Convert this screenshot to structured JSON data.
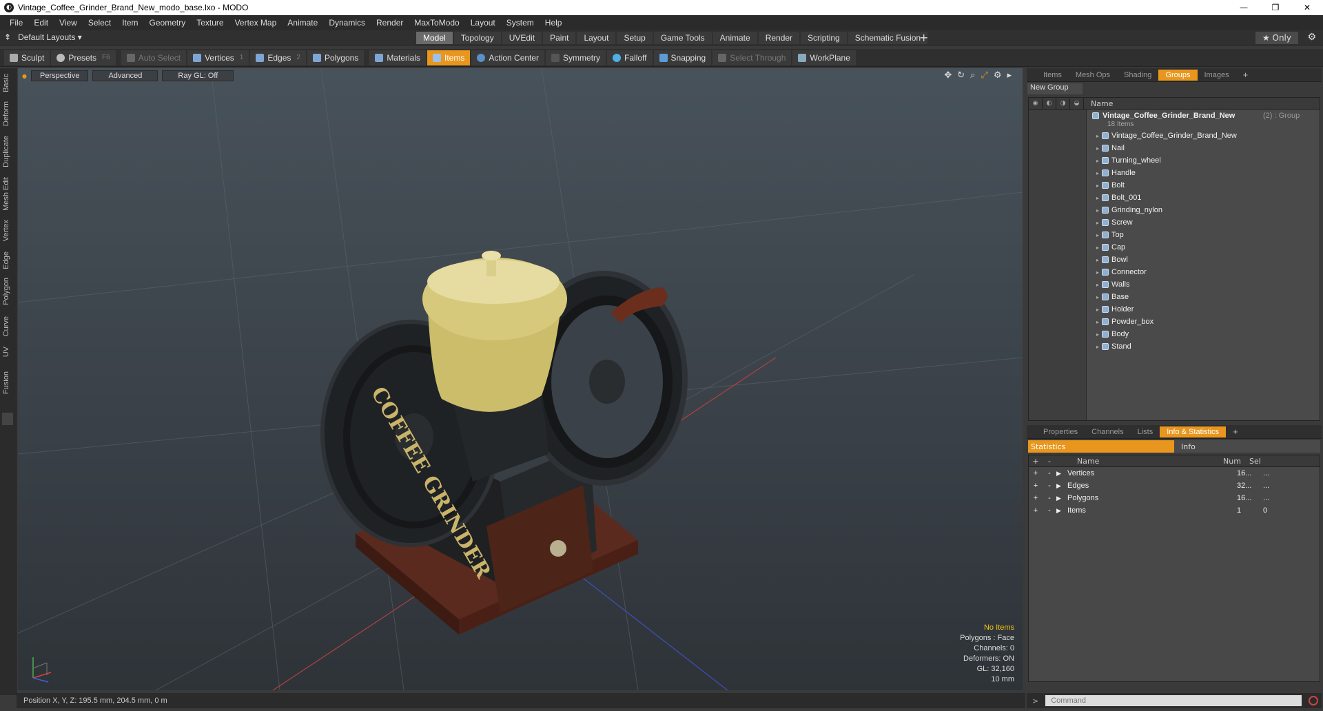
{
  "window": {
    "title": "Vintage_Coffee_Grinder_Brand_New_modo_base.lxo - MODO",
    "minimize": "—",
    "maximize": "❐",
    "close": "✕"
  },
  "menu": [
    "File",
    "Edit",
    "View",
    "Select",
    "Item",
    "Geometry",
    "Texture",
    "Vertex Map",
    "Animate",
    "Dynamics",
    "Render",
    "MaxToModo",
    "Layout",
    "System",
    "Help"
  ],
  "layouts": {
    "label": "Default Layouts ▾"
  },
  "mode_tabs": [
    "Model",
    "Topology",
    "UVEdit",
    "Paint",
    "Layout",
    "Setup",
    "Game Tools",
    "Animate",
    "Render",
    "Scripting",
    "Schematic Fusion"
  ],
  "mode_active": "Model",
  "only_label": "★ Only",
  "toolbar": {
    "sculpt": "Sculpt",
    "presets": "Presets",
    "presets_key": "F6",
    "auto_select": "Auto Select",
    "vertices": "Vertices",
    "vertices_key": "1",
    "edges": "Edges",
    "edges_key": "2",
    "polygons": "Polygons",
    "materials": "Materials",
    "items": "Items",
    "action_center": "Action Center",
    "symmetry": "Symmetry",
    "falloff": "Falloff",
    "snapping": "Snapping",
    "select_through": "Select Through",
    "workplane": "WorkPlane"
  },
  "left_tabs": [
    "Basic",
    "Deform",
    "Duplicate",
    "Mesh Edit",
    "Vertex",
    "Edge",
    "Polygon",
    "Curve",
    "UV",
    "Fusion"
  ],
  "viewport": {
    "perspective": "Perspective",
    "advanced": "Advanced",
    "raygl": "Ray GL: Off",
    "info": {
      "no_items": "No Items",
      "polygons": "Polygons : Face",
      "channels": "Channels: 0",
      "deformers": "Deformers: ON",
      "gl": "GL: 32,160",
      "scale": "10 mm"
    }
  },
  "status": {
    "position": "Position X, Y, Z:   195.5 mm, 204.5 mm, 0 m"
  },
  "right_tabs_top": [
    "Items",
    "Mesh Ops",
    "Shading",
    "Groups",
    "Images"
  ],
  "right_tabs_top_active": "Groups",
  "new_group": "New Group",
  "groups": {
    "name_header": "Name",
    "group_name": "Vintage_Coffee_Grinder_Brand_New",
    "group_suffix": "(2) : Group",
    "count": "18 Items",
    "items": [
      "Vintage_Coffee_Grinder_Brand_New",
      "Nail",
      "Turning_wheel",
      "Handle",
      "Bolt",
      "Bolt_001",
      "Grinding_nylon",
      "Screw",
      "Top",
      "Cap",
      "Bowl",
      "Connector",
      "Walls",
      "Base",
      "Holder",
      "Powder_box",
      "Body",
      "Stand"
    ]
  },
  "right_tabs_bottom": [
    "Properties",
    "Channels",
    "Lists",
    "Info & Statistics"
  ],
  "right_tabs_bottom_active": "Info & Statistics",
  "stats": {
    "tab_a": "Statistics",
    "tab_b": "Info",
    "h_name": "Name",
    "h_num": "Num",
    "h_sel": "Sel",
    "rows": [
      {
        "name": "Vertices",
        "num": "16...",
        "sel": "..."
      },
      {
        "name": "Edges",
        "num": "32...",
        "sel": "..."
      },
      {
        "name": "Polygons",
        "num": "16...",
        "sel": "..."
      },
      {
        "name": "Items",
        "num": "1",
        "sel": "0"
      }
    ]
  },
  "command": {
    "placeholder": "Command"
  },
  "model_text": "COFFEE GRINDER"
}
